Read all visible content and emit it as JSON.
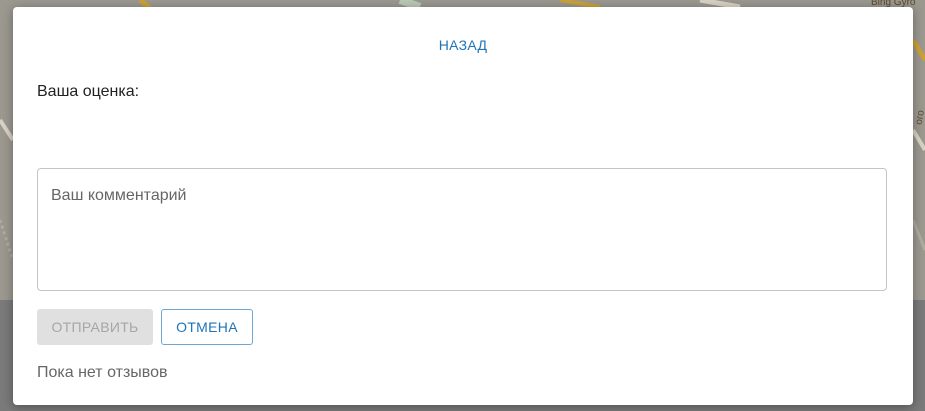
{
  "modal": {
    "back_label": "НАЗАД",
    "rating_label": "Ваша оценка:",
    "comment_placeholder": "Ваш комментарий",
    "comment_value": "",
    "submit_label": "ОТПРАВИТЬ",
    "cancel_label": "ОТМЕНА",
    "reviews_status": "Пока нет отзывов"
  },
  "background_map": {
    "labels": [
      "Bing Gyro",
      "ого"
    ]
  },
  "colors": {
    "accent": "#1f73b7",
    "disabled_bg": "#e0e0e0",
    "disabled_text": "#a6a6a6",
    "overlay": "#7f7f7f"
  }
}
